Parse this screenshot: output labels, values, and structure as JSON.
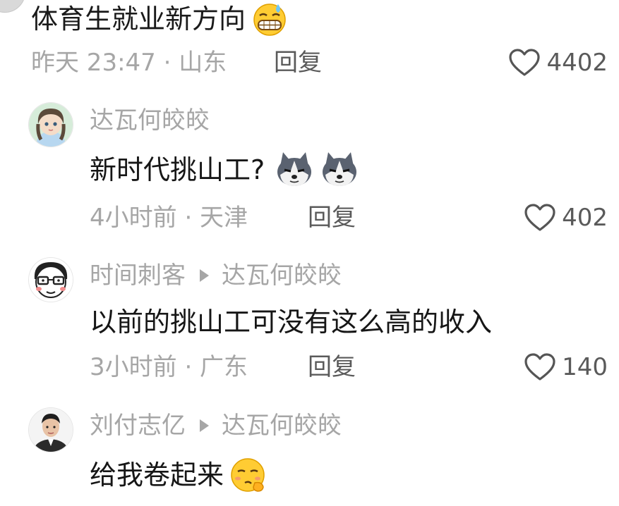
{
  "top_comment": {
    "text": "体育生就业新方向",
    "emoji": "grinning-sweat-emoji",
    "meta": {
      "time_location": "昨天 23:47 · 山东",
      "reply_label": "回复",
      "likes": "4402"
    }
  },
  "replies": [
    {
      "author": "达瓦何皎皎",
      "reply_to": "",
      "avatar": "anime-girl-avatar",
      "text": "新时代挑山工?",
      "emojis": [
        "husky-emoji",
        "husky-emoji"
      ],
      "time_location": "4小时前 · 天津",
      "reply_label": "回复",
      "likes": "402"
    },
    {
      "author": "时间刺客",
      "reply_to": "达瓦何皎皎",
      "avatar": "cartoon-glasses-avatar",
      "text": "以前的挑山工可没有这么高的收入",
      "emojis": [],
      "time_location": "3小时前 · 广东",
      "reply_label": "回复",
      "likes": "140"
    },
    {
      "author": "刘付志亿",
      "reply_to": "达瓦何皎皎",
      "avatar": "portrait-photo-avatar",
      "text": "给我卷起来",
      "emojis": [
        "smirking-emoji"
      ],
      "time_location": "",
      "reply_label": "",
      "likes": ""
    }
  ],
  "icons": {
    "like": "heart-outline-icon",
    "reply_arrow": "triangle-right-icon"
  },
  "colors": {
    "meta_text": "#a6a6a6",
    "action_text": "#5a5a5a",
    "body_text": "#161616"
  }
}
